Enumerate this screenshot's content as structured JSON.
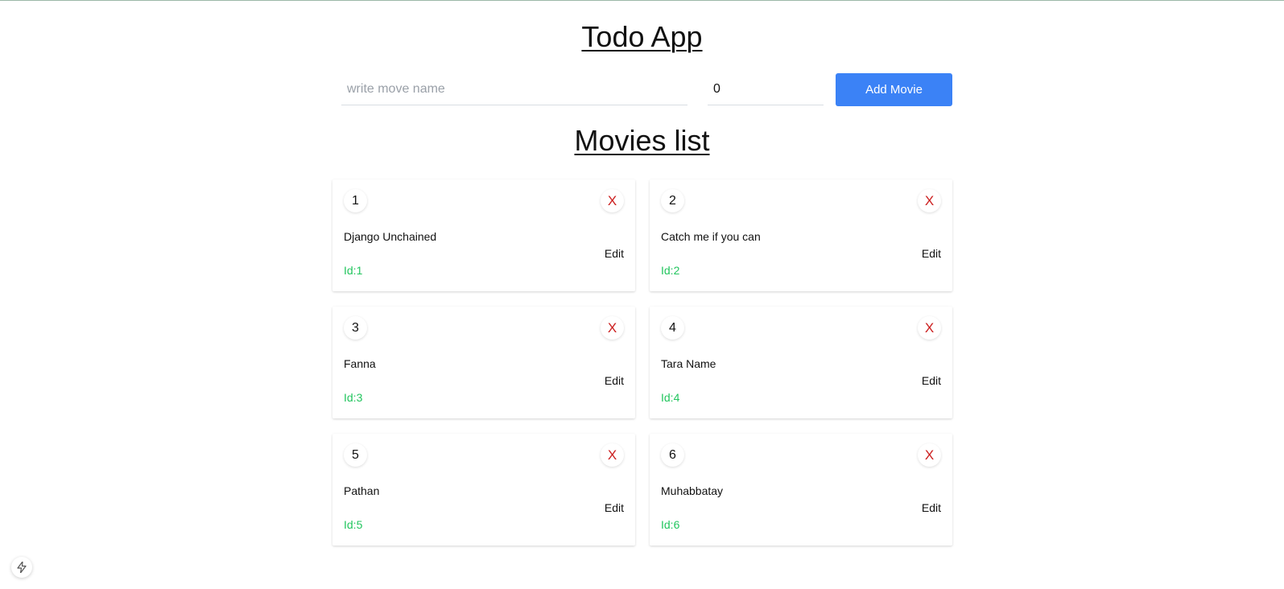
{
  "app": {
    "title": "Todo App"
  },
  "form": {
    "name_placeholder": "write move name",
    "name_value": "",
    "count_value": "0",
    "add_label": "Add Movie"
  },
  "list": {
    "title": "Movies list",
    "edit_label": "Edit",
    "delete_label": "X"
  },
  "movies": [
    {
      "number": "1",
      "name": "Django Unchained",
      "id_text": "Id:1"
    },
    {
      "number": "2",
      "name": "Catch me if you can",
      "id_text": "Id:2"
    },
    {
      "number": "3",
      "name": "Fanna",
      "id_text": "Id:3"
    },
    {
      "number": "4",
      "name": "Tara Name",
      "id_text": "Id:4"
    },
    {
      "number": "5",
      "name": "Pathan",
      "id_text": "Id:5"
    },
    {
      "number": "6",
      "name": "Muhabbatay",
      "id_text": "Id:6"
    }
  ],
  "colors": {
    "accent": "#3b82f6",
    "delete": "#cc1f1f",
    "id_text": "#22c55e"
  },
  "icons": {
    "fab": "lightning-bolt-icon"
  }
}
